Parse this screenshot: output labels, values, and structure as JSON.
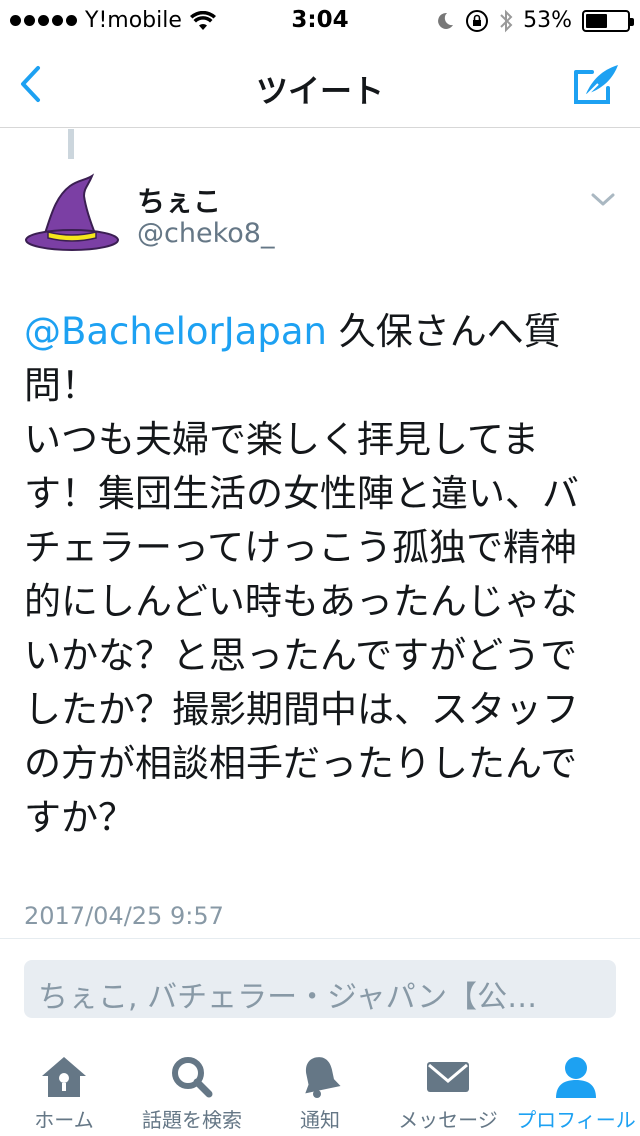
{
  "status_bar": {
    "carrier": "Y!mobile",
    "time": "3:04",
    "battery_text": "53%",
    "battery_level": 0.53
  },
  "nav": {
    "title": "ツイート"
  },
  "tweet": {
    "user_name": "ちぇこ",
    "user_handle": "@cheko8_",
    "mention": "@BachelorJapan",
    "text": " 久保さんへ質問！\nいつも夫婦で楽しく拝見してます！集団生活の女性陣と違い、バチェラーってけっこう孤独で精神的にしんどい時もあったんじゃないかな？と思ったんですがどうでしたか？撮影期間中は、スタッフの方が相談相手だったりしたんですか？",
    "timestamp": "2017/04/25 9:57"
  },
  "reply": {
    "placeholder": "ちぇこ, バチェラー・ジャパン【公…"
  },
  "tabs": [
    {
      "label": "ホーム",
      "icon": "home-icon"
    },
    {
      "label": "話題を検索",
      "icon": "search-icon"
    },
    {
      "label": "通知",
      "icon": "bell-icon"
    },
    {
      "label": "メッセージ",
      "icon": "mail-icon"
    },
    {
      "label": "プロフィール",
      "icon": "profile-icon",
      "active": true
    }
  ],
  "colors": {
    "accent": "#1da1f2",
    "inactive_icon": "#657786",
    "text": "#14171a"
  }
}
